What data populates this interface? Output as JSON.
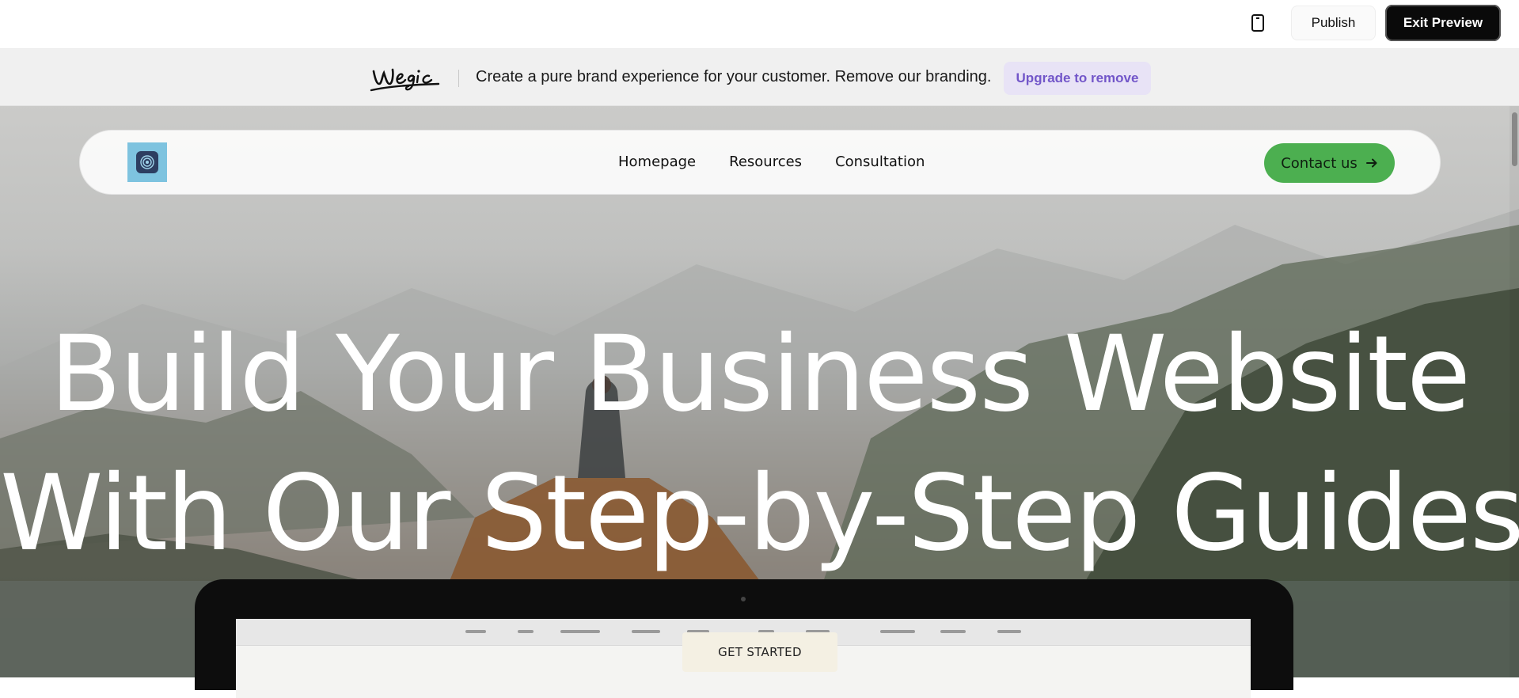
{
  "editor": {
    "device_icon": "mobile-device-icon",
    "publish_label": "Publish",
    "exit_label": "Exit Preview"
  },
  "branding": {
    "logo_text": "Wegic",
    "message": "Create a pure brand experience for your customer. Remove our branding.",
    "upgrade_label": "Upgrade to remove",
    "upgrade_color": "#7256c9"
  },
  "site_nav": {
    "logo_icon": "spiral-logo-icon",
    "links": [
      "Homepage",
      "Resources",
      "Consultation"
    ],
    "contact_label": "Contact us",
    "contact_icon": "arrow-right-icon",
    "contact_color": "#4caf50"
  },
  "hero": {
    "headline_line1": "Build Your Business Website",
    "headline_line2": "With Our Step-by-Step Guides",
    "cta_label": "GET STARTED"
  }
}
